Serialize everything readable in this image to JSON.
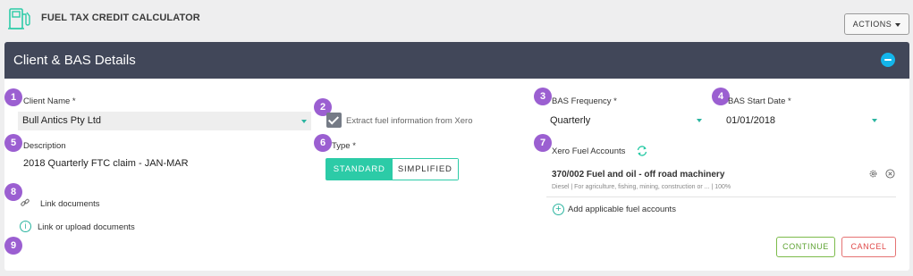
{
  "app": {
    "title": "FUEL TAX CREDIT CALCULATOR",
    "actions_label": "ACTIONS"
  },
  "card": {
    "title": "Client & BAS Details"
  },
  "badges": [
    "1",
    "2",
    "3",
    "4",
    "5",
    "6",
    "7",
    "8",
    "9"
  ],
  "client": {
    "label": "Client Name *",
    "value": "Bull Antics Pty Ltd"
  },
  "extract": {
    "label": "Extract fuel information from Xero",
    "checked": true
  },
  "bas_frequency": {
    "label": "BAS Frequency *",
    "value": "Quarterly"
  },
  "bas_start": {
    "label": "BAS Start Date *",
    "value": "01/01/2018"
  },
  "description": {
    "label": "Description",
    "value": "2018 Quarterly FTC claim - JAN-MAR"
  },
  "type": {
    "label": "Type *",
    "options": [
      "STANDARD",
      "SIMPLIFIED"
    ],
    "selected": "STANDARD"
  },
  "fuel_accounts": {
    "label": "Xero Fuel Accounts",
    "items": [
      {
        "name": "370/002 Fuel and oil - off road machinery",
        "detail": "Diesel | For agriculture, fishing, mining, construction or ... | 100%"
      }
    ],
    "add_label": "Add applicable fuel accounts"
  },
  "documents": {
    "link_label": "Link documents",
    "upload_label": "Link or upload documents"
  },
  "buttons": {
    "continue": "CONTINUE",
    "cancel": "CANCEL"
  },
  "colors": {
    "header": "#414759",
    "accent": "#2ccba7",
    "badge": "#9b5fd1",
    "continue": "#7cbb4b",
    "cancel": "#e04848"
  }
}
